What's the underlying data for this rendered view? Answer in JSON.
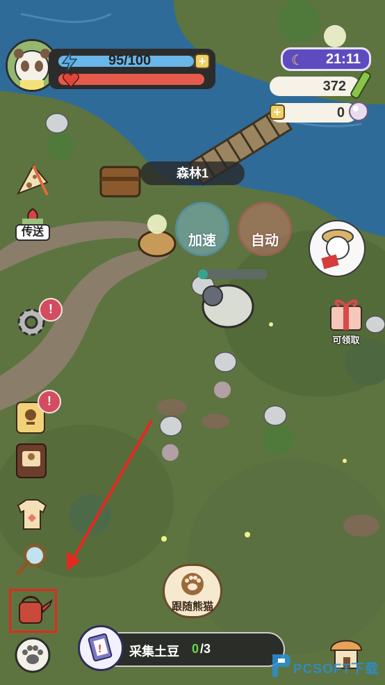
{
  "hud": {
    "energy": {
      "value": "95/100",
      "fraction": 0.95
    },
    "health": {
      "fraction": 1.0
    },
    "clock": "21:11",
    "bamboo_count": "372",
    "pearl_count": "0",
    "plus_symbol": "+"
  },
  "map": {
    "area_name": "森林1"
  },
  "actions": {
    "speed_up": "加速",
    "auto": "自动",
    "progress_fraction": 0.14
  },
  "sidebar": {
    "teleport": "传送",
    "alert_mark": "!",
    "gift_label": "可领取"
  },
  "bottom": {
    "follow_panda": "跟随熊猫",
    "quest_text": "采集土豆",
    "quest_done": "0",
    "quest_total": "/3"
  },
  "watermark": "PCSOFT下载"
}
